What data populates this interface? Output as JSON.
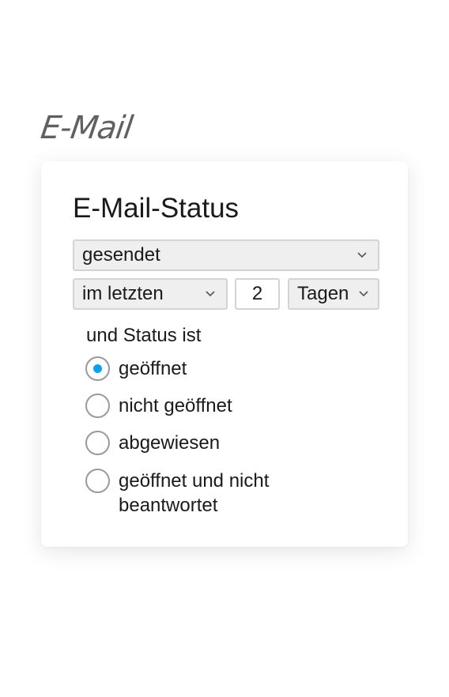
{
  "section": {
    "heading": "E-Mail"
  },
  "card": {
    "title": "E-Mail-Status",
    "event_select": {
      "value": "gesendet",
      "icon": "chevron-down-icon"
    },
    "range_select": {
      "value": "im letzten",
      "icon": "chevron-down-icon"
    },
    "count_input": {
      "value": "2"
    },
    "unit_select": {
      "value": "Tagen",
      "icon": "chevron-down-icon"
    },
    "status_label": "und Status ist",
    "status_options": [
      {
        "label": "geöffnet",
        "selected": true
      },
      {
        "label": "nicht geöffnet",
        "selected": false
      },
      {
        "label": "abgewiesen",
        "selected": false
      },
      {
        "label": "geöffnet und nicht beantwortet",
        "selected": false
      }
    ]
  },
  "colors": {
    "accent": "#0aa2e8",
    "heading_gray": "#606060",
    "control_bg": "#efefef",
    "control_border": "#d4d4d4"
  }
}
